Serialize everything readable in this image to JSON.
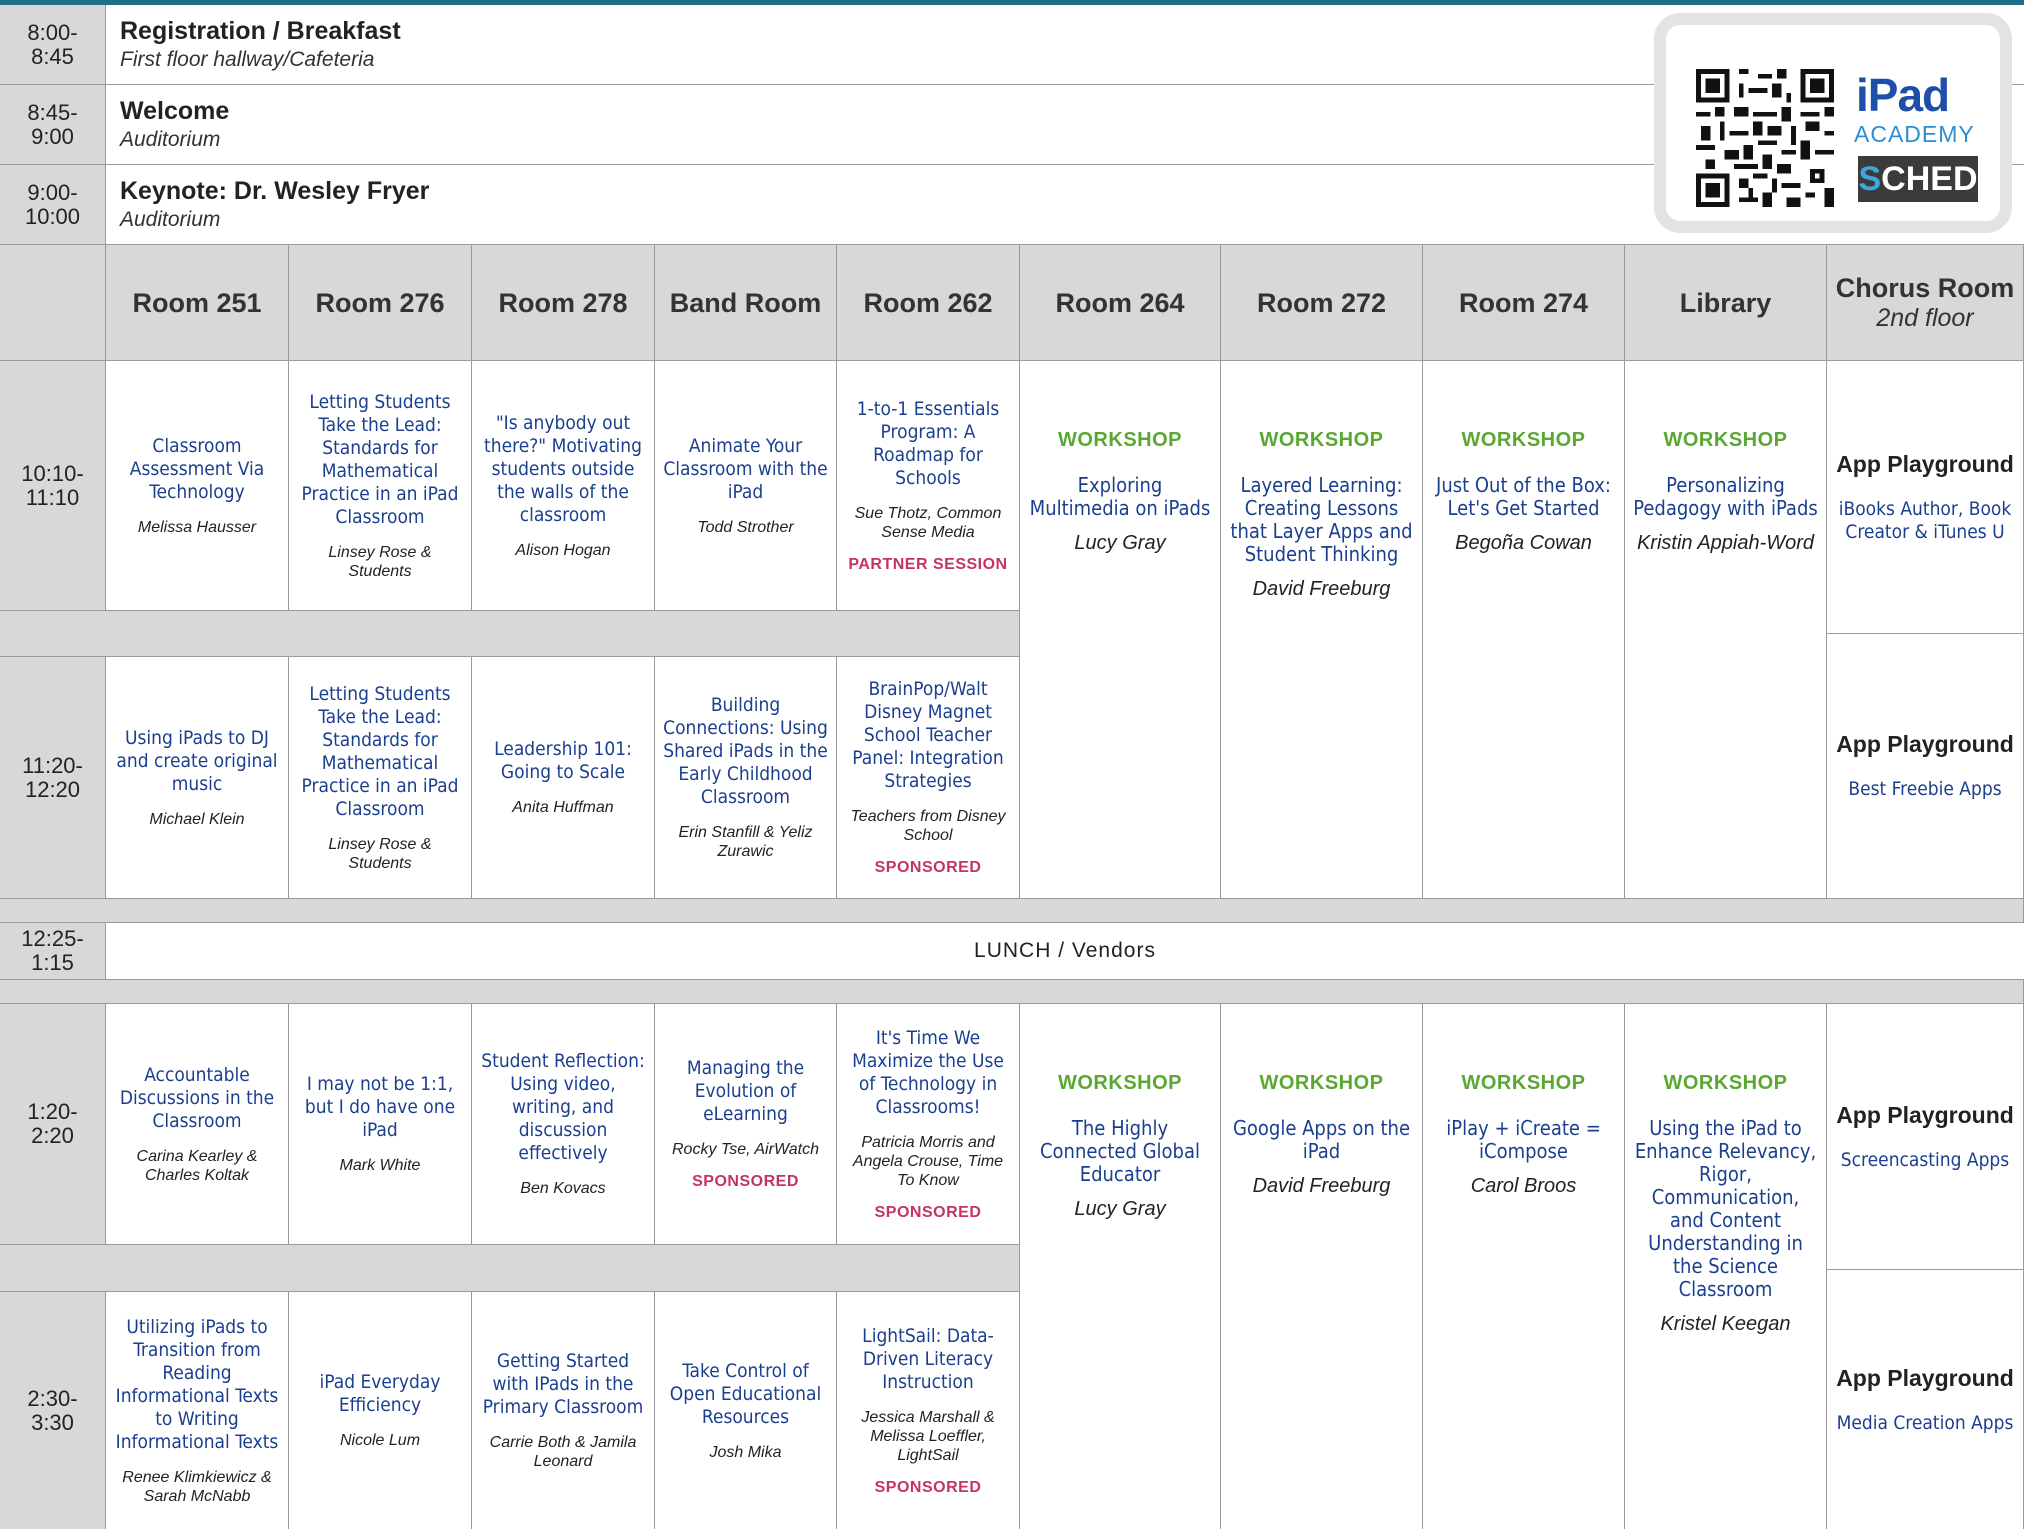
{
  "top_rows": [
    {
      "time1": "8:00-",
      "time2": "8:45",
      "title": "Registration / Breakfast",
      "location": "First floor hallway/Cafeteria"
    },
    {
      "time1": "8:45-",
      "time2": "9:00",
      "title": "Welcome",
      "location": "Auditorium"
    },
    {
      "time1": "9:00-",
      "time2": "10:00",
      "title": "Keynote:  Dr. Wesley Fryer",
      "location": "Auditorium"
    }
  ],
  "badge": {
    "brand": "iPad",
    "brand2": "ACADEMY",
    "sched1": "S",
    "sched2": "CHED"
  },
  "rooms": [
    {
      "name": "Room 251"
    },
    {
      "name": "Room 276"
    },
    {
      "name": "Room 278"
    },
    {
      "name": "Band Room"
    },
    {
      "name": "Room 262"
    },
    {
      "name": "Room 264"
    },
    {
      "name": "Room 272"
    },
    {
      "name": "Room 274"
    },
    {
      "name": "Library"
    },
    {
      "name": "Chorus Room",
      "sub": "2nd floor"
    }
  ],
  "slots": [
    {
      "time1": "10:10-",
      "time2": "11:10"
    },
    {
      "time1": "11:20-",
      "time2": "12:20"
    },
    {
      "time1": "12:25-",
      "time2": "1:15"
    },
    {
      "time1": "1:20-",
      "time2": "2:20"
    },
    {
      "time1": "2:30-",
      "time2": "3:30"
    }
  ],
  "lunch": "LUNCH / Vendors",
  "s1": [
    {
      "title": "Classroom Assessment Via Technology",
      "presenter": "Melissa Hausser"
    },
    {
      "title": "Letting Students Take the Lead: Standards for Mathematical Practice in an iPad Classroom",
      "presenter": "Linsey Rose & Students"
    },
    {
      "title": "\"Is anybody out there?\" Motivating students outside the walls of the classroom",
      "presenter": "Alison Hogan"
    },
    {
      "title": "Animate Your Classroom with the iPad",
      "presenter": "Todd Strother"
    },
    {
      "title": "1-to-1 Essentials Program: A Roadmap for Schools",
      "presenter": "Sue Thotz, Common Sense Media",
      "tag": "PARTNER SESSION"
    }
  ],
  "s2": [
    {
      "title": "Using iPads to DJ and create original music",
      "presenter": "Michael Klein"
    },
    {
      "title": "Letting Students Take the Lead: Standards for Mathematical Practice in an iPad Classroom",
      "presenter": "Linsey Rose & Students"
    },
    {
      "title": "Leadership 101: Going to Scale",
      "presenter": "Anita Huffman"
    },
    {
      "title": "Building Connections: Using Shared iPads in the Early Childhood Classroom",
      "presenter": "Erin Stanfill & Yeliz Zurawic"
    },
    {
      "title": "BrainPop/Walt Disney Magnet School Teacher Panel: Integration Strategies",
      "presenter": "Teachers from Disney School",
      "tag": "SPONSORED"
    }
  ],
  "s3": [
    {
      "title": "Accountable Discussions in the Classroom",
      "presenter": "Carina Kearley & Charles Koltak"
    },
    {
      "title": "I may not be 1:1, but I do have one iPad",
      "presenter": "Mark White"
    },
    {
      "title": "Student Reflection: Using video, writing, and discussion effectively",
      "presenter": "Ben Kovacs"
    },
    {
      "title": "Managing the Evolution of eLearning",
      "presenter": "Rocky Tse, AirWatch",
      "tag": "SPONSORED"
    },
    {
      "title": "It's Time We Maximize the Use of Technology in Classrooms!",
      "presenter": "Patricia Morris and Angela Crouse, Time To Know",
      "tag": "SPONSORED"
    }
  ],
  "s4": [
    {
      "title": "Utilizing iPads to Transition from Reading Informational Texts to Writing Informational Texts",
      "presenter": "Renee Klimkiewicz & Sarah McNabb"
    },
    {
      "title": "iPad Everyday Efficiency",
      "presenter": "Nicole Lum"
    },
    {
      "title": "Getting Started with IPads in the Primary Classroom",
      "presenter": "Carrie Both & Jamila Leonard"
    },
    {
      "title": "Take Control of Open Educational Resources",
      "presenter": "Josh Mika"
    },
    {
      "title": "LightSail: Data-Driven Literacy Instruction",
      "presenter": "Jessica Marshall & Melissa Loeffler, LightSail",
      "tag": "SPONSORED"
    }
  ],
  "workshop_label": "WORKSHOP",
  "workshops_am": [
    {
      "title": "Exploring Multimedia on iPads",
      "presenter": "Lucy Gray"
    },
    {
      "title": "Layered Learning: Creating Lessons that Layer Apps and Student Thinking",
      "presenter": "David Freeburg"
    },
    {
      "title": "Just Out of the Box: Let's Get Started",
      "presenter": "Begoña Cowan"
    },
    {
      "title": "Personalizing Pedagogy with iPads",
      "presenter": "Kristin Appiah-Word"
    }
  ],
  "workshops_pm": [
    {
      "title": "The Highly Connected Global Educator",
      "presenter": "Lucy Gray"
    },
    {
      "title": "Google Apps on the iPad",
      "presenter": "David  Freeburg"
    },
    {
      "title": "iPlay + iCreate = iCompose",
      "presenter": "Carol Broos"
    },
    {
      "title": "Using the iPad to Enhance Relevancy, Rigor, Communication, and Content Understanding in the Science Classroom",
      "presenter": "Kristel Keegan"
    }
  ],
  "playground_label": "App Playground",
  "playgrounds": [
    {
      "title": "iBooks Author, Book Creator & iTunes U"
    },
    {
      "title": "Best Freebie Apps"
    },
    {
      "title": "Screencasting Apps"
    },
    {
      "title": "Media Creation Apps"
    }
  ],
  "colors": {
    "title_blue": "#1b3f8f",
    "workshop_green": "#5aa832",
    "sponsored_pink": "#c4326a",
    "gray": "#d8d8d8"
  }
}
